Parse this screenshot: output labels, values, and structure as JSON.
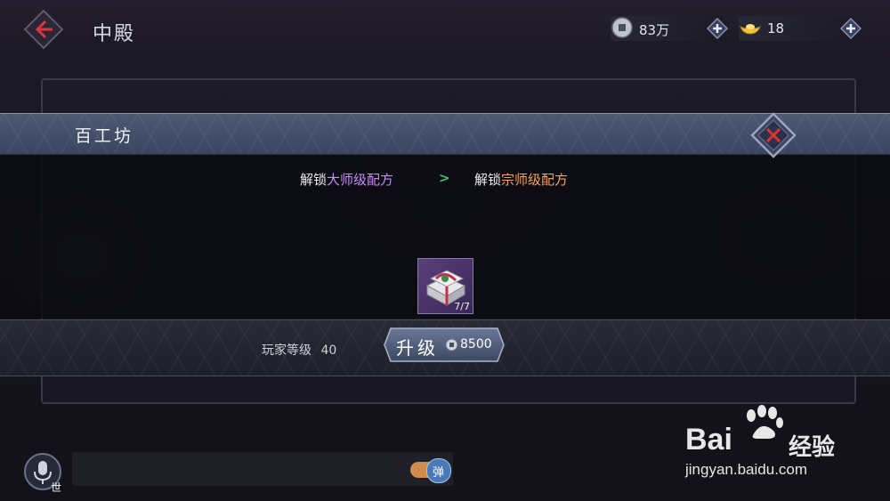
{
  "header": {
    "title": "中殿",
    "currency_silver": {
      "value": "83万",
      "icon": "silver-coin-icon"
    },
    "currency_gold": {
      "value": "18",
      "icon": "gold-ingot-icon"
    }
  },
  "modal": {
    "title": "百工坊",
    "unlock_prefix_1": "解锁",
    "unlock_tier_1": "大师级配方",
    "unlock_arrow": ">",
    "unlock_prefix_2": "解锁",
    "unlock_tier_2": "宗师级配方",
    "item": {
      "count": "7/7",
      "icon": "gift-box-icon"
    },
    "player_level_label": "玩家等级",
    "player_level_value": "40",
    "upgrade": {
      "label": "升级",
      "cost": "8500",
      "coin_icon": "silver-coin-icon"
    }
  },
  "footer": {
    "mic_channel": "世",
    "barrage_toggle": "弹"
  },
  "watermark": {
    "brand": "Bai",
    "brand_suffix": "经验",
    "url": "jingyan.baidu.com"
  },
  "colors": {
    "purple_tier": "#c58cf5",
    "orange_tier": "#f2a35a",
    "arrow_green": "#3fbf7a",
    "close_red": "#e0303a"
  }
}
